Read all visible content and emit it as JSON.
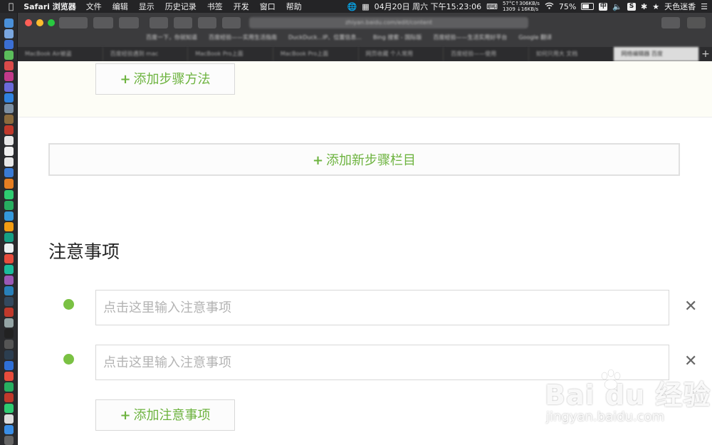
{
  "menubar": {
    "app_name": "Safari 浏览器",
    "menus": [
      "文件",
      "编辑",
      "显示",
      "历史记录",
      "书签",
      "开发",
      "窗口",
      "帮助"
    ],
    "datetime": "04月20日 周六 下午15:23:06",
    "net_top": "57°C↑306KB/s",
    "net_bottom": "1309 ↓16KB/s",
    "battery": "75%",
    "battery_level": 0.75,
    "input_method": "中",
    "user": "天色迷香"
  },
  "browser": {
    "url": "zhiyan.baidu.com/edit/content",
    "favorites": [
      "百度一下，你就知道",
      "百度经验——实用生活指南",
      "DuckDuck...IP、位置信息...",
      "Bing 搜索 - 国际版",
      "百度经验——生活实用好平台",
      "Google 翻译"
    ],
    "tabs": [
      "MacBook Air被盗",
      "百度经验遇到 mac",
      "MacBook Pro上面",
      "MacBook Pro上面",
      "网页收藏 个人常用",
      "百度经验——使用",
      "如何只用大 文档",
      "网络编辑器 百度"
    ]
  },
  "page": {
    "add_step_method": "添加步骤方法",
    "add_step_section": "添加新步骤栏目",
    "notes_title": "注意事项",
    "notes": [
      {
        "value": "",
        "placeholder": "点击这里输入注意事项"
      },
      {
        "value": "",
        "placeholder": "点击这里输入注意事项"
      }
    ],
    "add_note": "添加注意事项",
    "plus_symbol": "+",
    "close_symbol": "✕"
  },
  "watermark": {
    "logo": "Bai du 经验",
    "url": "jingyan.baidu.com"
  },
  "colors": {
    "accent_green": "#6db33f",
    "dot_green": "#7ac143"
  }
}
